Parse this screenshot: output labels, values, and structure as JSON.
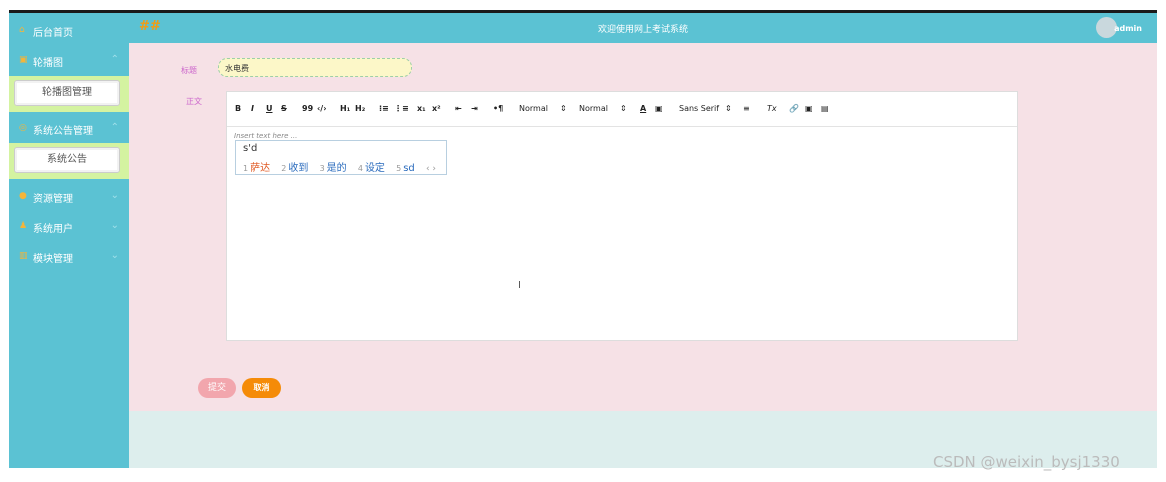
{
  "header": {
    "system_title": "欢迎使用网上考试系统",
    "username": "admin",
    "logo_glyph": "##"
  },
  "sidebar": {
    "items": [
      {
        "label": "后台首页",
        "icon": "home-icon"
      },
      {
        "label": "轮播图",
        "icon": "image-icon",
        "expanded": true,
        "children": [
          "轮播图管理"
        ]
      },
      {
        "label": "系统公告管理",
        "icon": "notice-icon",
        "expanded": true,
        "children": [
          "系统公告"
        ]
      },
      {
        "label": "资源管理",
        "icon": "resource-icon"
      },
      {
        "label": "系统用户",
        "icon": "user-icon"
      },
      {
        "label": "模块管理",
        "icon": "module-icon"
      }
    ]
  },
  "form": {
    "title_label": "标题",
    "title_value": "水电费",
    "body_label": "正文",
    "editor_placeholder": "Insert text here ...",
    "toolbar": {
      "bold": "B",
      "italic": "I",
      "underline": "U",
      "strike": "S",
      "quote": "99",
      "code": "‹/›",
      "h1": "H₁",
      "h2": "H₂",
      "ol": "⁝≡",
      "ul": "⋮≡",
      "sub": "x₁",
      "sup": "x²",
      "outdent": "⇤",
      "indent": "⇥",
      "direction": "•¶",
      "size": "Normal",
      "header": "Normal",
      "font": "Sans Serif",
      "color": "A",
      "bg": "▣",
      "align": "≡",
      "clean": "Tx",
      "link": "🔗",
      "image": "▣",
      "video": "▤"
    },
    "submit_label": "提交",
    "cancel_label": "取消"
  },
  "ime": {
    "input": "s'd",
    "candidates": [
      {
        "n": "1",
        "text": "萨达"
      },
      {
        "n": "2",
        "text": "收到"
      },
      {
        "n": "3",
        "text": "是的"
      },
      {
        "n": "4",
        "text": "设定"
      },
      {
        "n": "5",
        "text": "sd"
      }
    ],
    "next": "‹ ›"
  },
  "watermark": "CSDN @weixin_bysj1330",
  "colors": {
    "sidebar": "#5bc2d3",
    "main_bg": "#f6e1e6",
    "submenu_bg": "#d4f3a1",
    "cancel": "#f58b08",
    "submit": "#f2a6ad"
  }
}
